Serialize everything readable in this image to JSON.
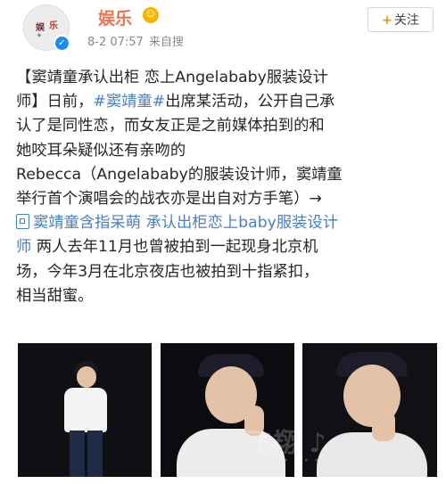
{
  "account": {
    "name": "娱乐",
    "timestamp": "8-2 07:57",
    "source": "来自搜",
    "follow_label": "关注",
    "follow_plus": "+"
  },
  "post": {
    "lines": [
      {
        "segments": [
          {
            "text": "【窦靖童承认出柜 恋上Angelababy服装设计"
          }
        ]
      },
      {
        "segments": [
          {
            "text": "师】日前，"
          },
          {
            "text": "#窦靖童#",
            "type": "topic"
          },
          {
            "text": "出席某活动，公开自己承"
          }
        ]
      },
      {
        "segments": [
          {
            "text": "认了是同性恋，而女友正是之前媒体拍到的和"
          }
        ]
      },
      {
        "segments": [
          {
            "text": "她咬耳朵疑似还有亲吻的"
          }
        ]
      },
      {
        "segments": [
          {
            "text": "Rebecca（Angelababy的服装设计师，窦靖童"
          }
        ]
      },
      {
        "segments": [
          {
            "text": "举行首个演唱会的战衣亦是出自对方手笔）→"
          }
        ]
      },
      {
        "segments": [
          {
            "text": "窦靖童含指呆萌 承认出柜恋上baby服装设计",
            "type": "link",
            "icon": true
          }
        ]
      },
      {
        "segments": [
          {
            "text": "师",
            "type": "link"
          },
          {
            "text": " 两人去年11月也曾被拍到一起现身北京机"
          }
        ]
      },
      {
        "segments": [
          {
            "text": "场，今年3月在北京夜店也被拍到十指紧扣，"
          }
        ]
      },
      {
        "segments": [
          {
            "text": "相当甜蜜。"
          }
        ]
      }
    ]
  },
  "colors": {
    "username": "#eb7350",
    "topic": "#4a7fc1",
    "verified": "#1a8cf0",
    "follow_plus": "#f28c26"
  },
  "icons": {
    "verified": "verified-badge-icon",
    "level": "level-badge-icon",
    "link": "link-icon"
  }
}
